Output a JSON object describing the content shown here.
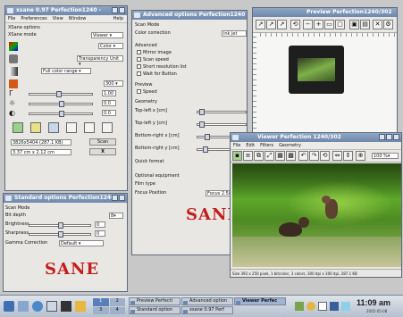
{
  "xsane": {
    "title": "xsane 0.97 Perfection1240 - ",
    "menu": [
      "File",
      "Preferences",
      "View",
      "Window",
      "Help"
    ],
    "section": "XSane options",
    "mode_label": "XSane mode",
    "mode_value": "Viewer",
    "color_value": "Color",
    "media_value": "Transparency Unit",
    "range_value": "Full color range",
    "resolution": "300",
    "gamma": "1.00",
    "brightness": "0.0",
    "contrast": "0.0",
    "size_info": "3826x5404 (287.1 KB)",
    "scan_btn": "Scan",
    "dims": "3.37 cm x 2.12 cm",
    "cancel_btn": "X"
  },
  "advanced": {
    "title": "Advanced options Perfection1240",
    "scan_mode": "Scan Mode",
    "color_correction": "Color correction",
    "color_correction_value": "ink jet",
    "advanced": "Advanced",
    "mirror": "Mirror image",
    "speed": "Scan speed",
    "short_res": "Short resolution list",
    "wait": "Wait for Button",
    "preview": "Preview",
    "preview_speed": "Speed",
    "geometry": "Geometry",
    "tlx": "Top-left x [cm]",
    "tly": "Top-left y [cm]",
    "brx": "Bottom-right x [cm]",
    "bry": "Bottom-right y [cm]",
    "quick": "Quick format",
    "optional": "Optional equipment",
    "film": "Film type",
    "focus": "Focus Position",
    "focus_value": "Focus 2.5i"
  },
  "standard": {
    "title": "Standard options Perfection1240",
    "scan_mode": "Scan Mode",
    "bit_depth": "Bit depth",
    "bit_depth_value": "8",
    "brightness": "Brightness",
    "brightness_value": "0",
    "sharpness": "Sharpness",
    "sharpness_value": "0",
    "gamma_correction": "Gamma Correction",
    "gamma_value": "Default"
  },
  "preview": {
    "title": "Preview Perfection1240/302"
  },
  "viewer": {
    "title": "Viewer Perfection 1240/302",
    "menu": [
      "File",
      "Edit",
      "Filters",
      "Geometry"
    ],
    "zoom": "100 %",
    "status": "Size 392 x 250 pixel, 1 bit/color, 3 colors, 300 dpi x 300 dpi, 287.1 KB"
  },
  "logo": {
    "text": "SANE"
  },
  "taskbar": {
    "tasks": [
      {
        "label": "Preview Perfecti"
      },
      {
        "label": "Advanced option"
      },
      {
        "label": "Viewer Perfec"
      },
      {
        "label": "Standard option"
      },
      {
        "label": "xsane 0.97 Perf"
      }
    ],
    "time": "11:09 am",
    "date": "2005-05-08"
  },
  "colors": {
    "title_bar": "#7590b4",
    "logo": "#c41d1d",
    "panel": "#e9e7e3"
  }
}
